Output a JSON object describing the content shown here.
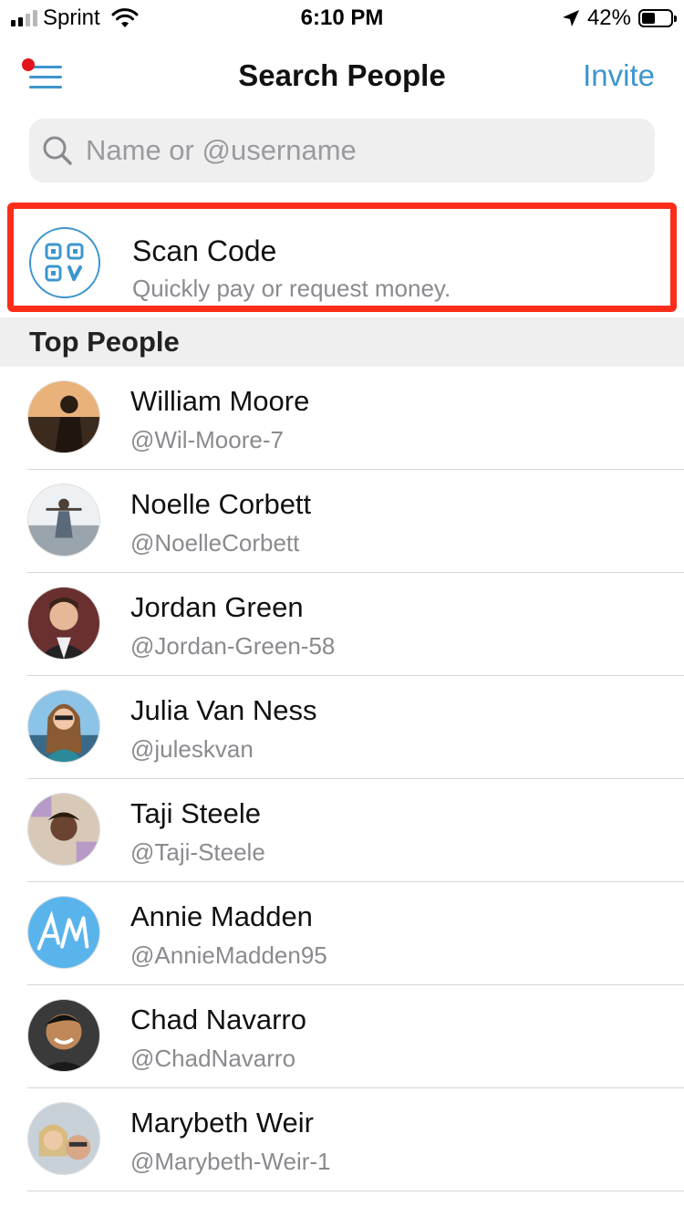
{
  "status_bar": {
    "carrier": "Sprint",
    "time": "6:10 PM",
    "battery": "42%"
  },
  "nav": {
    "title": "Search People",
    "invite_label": "Invite"
  },
  "search": {
    "placeholder": "Name or @username",
    "value": ""
  },
  "scan_code": {
    "title": "Scan Code",
    "subtitle": "Quickly pay or request money."
  },
  "section": {
    "title": "Top People"
  },
  "people": [
    {
      "name": "William Moore",
      "username": "@Wil-Moore-7"
    },
    {
      "name": "Noelle Corbett",
      "username": "@NoelleCorbett"
    },
    {
      "name": "Jordan Green",
      "username": "@Jordan-Green-58"
    },
    {
      "name": "Julia Van Ness",
      "username": "@juleskvan"
    },
    {
      "name": "Taji Steele",
      "username": "@Taji-Steele"
    },
    {
      "name": "Annie Madden",
      "username": "@AnnieMadden95"
    },
    {
      "name": "Chad Navarro",
      "username": "@ChadNavarro"
    },
    {
      "name": "Marybeth Weir",
      "username": "@Marybeth-Weir-1"
    }
  ],
  "colors": {
    "accent": "#3d95ce",
    "highlight_border": "#fb2d1a",
    "notification_dot": "#e4141b"
  }
}
